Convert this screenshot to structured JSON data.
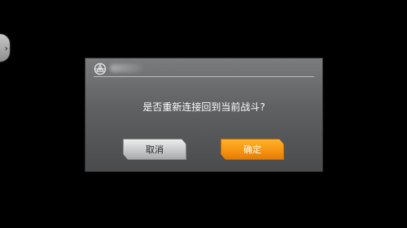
{
  "side_tab": {
    "icon": "chevron-right-icon",
    "glyph": "›"
  },
  "dialog": {
    "logo_icon": "game-logo-icon",
    "message": "是否重新连接回到当前战斗?",
    "buttons": {
      "cancel_label": "取消",
      "confirm_label": "确定"
    }
  },
  "colors": {
    "confirm_accent": "#f79414",
    "dialog_background": "#5e6062",
    "cancel_background": "#c7c9ca",
    "screen_background": "#000000"
  }
}
